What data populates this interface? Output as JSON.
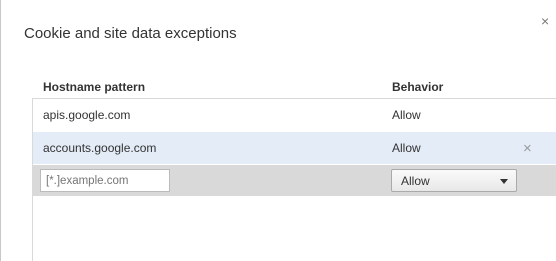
{
  "dialog": {
    "title": "Cookie and site data exceptions",
    "close_icon": "×"
  },
  "table": {
    "headers": {
      "hostname": "Hostname pattern",
      "behavior": "Behavior"
    },
    "rows": [
      {
        "hostname": "apis.google.com",
        "behavior": "Allow"
      },
      {
        "hostname": "accounts.google.com",
        "behavior": "Allow"
      }
    ],
    "delete_icon": "×",
    "new_entry": {
      "placeholder": "[*.]example.com",
      "behavior_selected": "Allow"
    }
  }
}
